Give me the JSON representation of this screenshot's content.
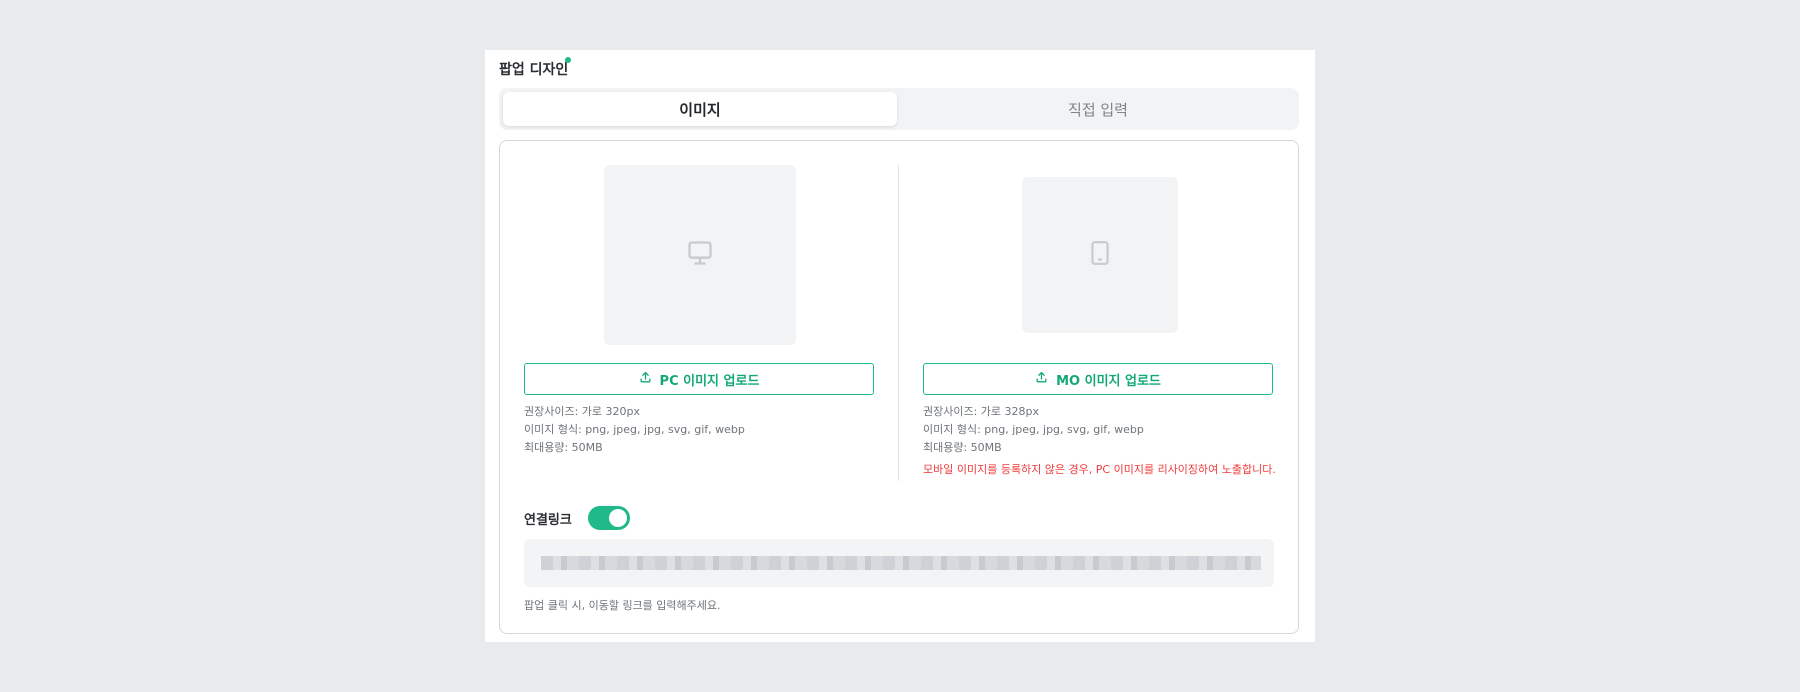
{
  "section": {
    "title": "팝업 디자인"
  },
  "tabs": [
    {
      "label": "이미지",
      "active": true
    },
    {
      "label": "직접 입력",
      "active": false
    }
  ],
  "pc": {
    "icon": "monitor-icon",
    "upload_label": "PC 이미지 업로드",
    "info": [
      "권장사이즈: 가로 320px",
      "이미지 형식: png, jpeg, jpg, svg, gif, webp",
      "최대용량: 50MB"
    ]
  },
  "mo": {
    "icon": "mobile-icon",
    "upload_label": "MO 이미지 업로드",
    "info": [
      "권장사이즈: 가로 328px",
      "이미지 형식: png, jpeg, jpg, svg, gif, webp",
      "최대용량: 50MB"
    ],
    "warning": "모바일 이미지를 등록하지 않은 경우, PC 이미지를 리사이징하여 노출합니다."
  },
  "link": {
    "label": "연결링크",
    "toggle_on": true,
    "helper": "팝업 클릭 시, 이동할 링크를 입력해주세요."
  },
  "colors": {
    "accent": "#1fb98a",
    "warning": "#ef3b3b",
    "page_bg": "#e8ebee"
  }
}
